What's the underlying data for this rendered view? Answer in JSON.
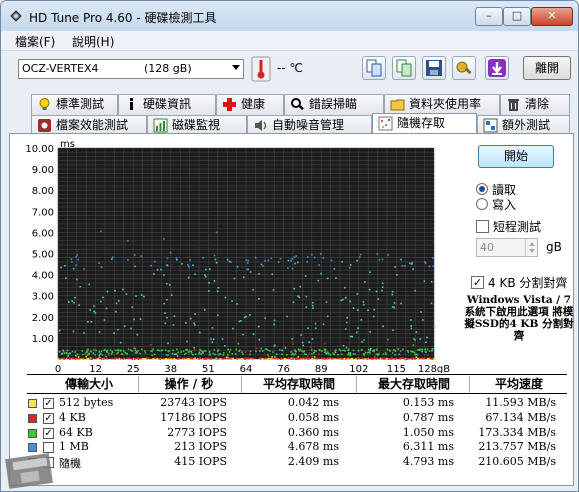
{
  "window": {
    "title": "HD Tune Pro 4.60 - 硬碟檢測工具",
    "min_glyph": "–",
    "max_glyph": "□",
    "close_glyph": "✕"
  },
  "menu": [
    "檔案(F)",
    "說明(H)"
  ],
  "toolbar": {
    "device_name": "OCZ-VERTEX4",
    "device_capacity": "(128 gB)",
    "temperature": "-- ℃",
    "exit_label": "離開"
  },
  "tabs_row1": [
    "標準測試",
    "硬碟資訊",
    "健康",
    "錯誤掃瞄",
    "資料夾使用率",
    "清除"
  ],
  "tabs_row2": [
    "檔案效能測試",
    "磁碟監視",
    "自動噪音管理",
    "隨機存取",
    "額外測試"
  ],
  "active_tab": "隨機存取",
  "controls": {
    "start_label": "開始",
    "read_label": "讀取",
    "write_label": "寫入",
    "short_test_label": "短程測試",
    "short_test_value": "40",
    "unit": "gB",
    "align_label": "4 KB 分割對齊",
    "align_checked": "✓",
    "note": "Windows Vista / 7 系統下啟用此選項 將模擬SSD的4 KB 分割對齊"
  },
  "chart_data": {
    "type": "scatter",
    "ylabel": "ms",
    "x_ticks": [
      "0",
      "12",
      "25",
      "38",
      "51",
      "64",
      "76",
      "89",
      "102",
      "115",
      "128gB"
    ],
    "y_ticks": [
      "10.00",
      "9.00",
      "8.00",
      "7.00",
      "6.00",
      "5.00",
      "4.00",
      "3.00",
      "2.00",
      "1.00"
    ],
    "xlim": [
      0,
      128
    ],
    "ylim": [
      0,
      10
    ],
    "grid": true,
    "series": [
      {
        "name": "512 bytes",
        "color": "#e8e800",
        "y_mean": 0.042,
        "y_max": 0.153
      },
      {
        "name": "4 KB",
        "color": "#d42a2a",
        "y_mean": 0.058,
        "y_max": 0.787
      },
      {
        "name": "64 KB",
        "color": "#3ec83e",
        "y_mean": 0.36,
        "y_max": 1.05
      },
      {
        "name": "1 MB",
        "color": "#4a90d8",
        "y_mean": 4.678,
        "y_max": 6.311
      },
      {
        "name": "隨機",
        "color": "#48d0d0",
        "y_mean": 2.409,
        "y_max": 4.793
      }
    ]
  },
  "table": {
    "headers": [
      "傳輸大小",
      "操作 / 秒",
      "平均存取時間",
      "最大存取時間",
      "平均速度"
    ],
    "rows": [
      {
        "label": "512 bytes",
        "color": "#f2e84a",
        "checked": "✓",
        "ops": "23743 IOPS",
        "avg": "0.042 ms",
        "max": "0.153 ms",
        "speed": "11.593 MB/s"
      },
      {
        "label": "4 KB",
        "color": "#d42a2a",
        "checked": "✓",
        "ops": "17186 IOPS",
        "avg": "0.058 ms",
        "max": "0.787 ms",
        "speed": "67.134 MB/s"
      },
      {
        "label": "64 KB",
        "color": "#3ec83e",
        "checked": "✓",
        "ops": "2773 IOPS",
        "avg": "0.360 ms",
        "max": "1.050 ms",
        "speed": "173.334 MB/s"
      },
      {
        "label": "1 MB",
        "color": "#4a90d8",
        "checked": "",
        "ops": "213 IOPS",
        "avg": "4.678 ms",
        "max": "6.311 ms",
        "speed": "213.757 MB/s"
      },
      {
        "label": "隨機",
        "color": "#48d0d0",
        "checked": "",
        "ops": "415 IOPS",
        "avg": "2.409 ms",
        "max": "4.793 ms",
        "speed": "210.605 MB/s"
      }
    ]
  }
}
